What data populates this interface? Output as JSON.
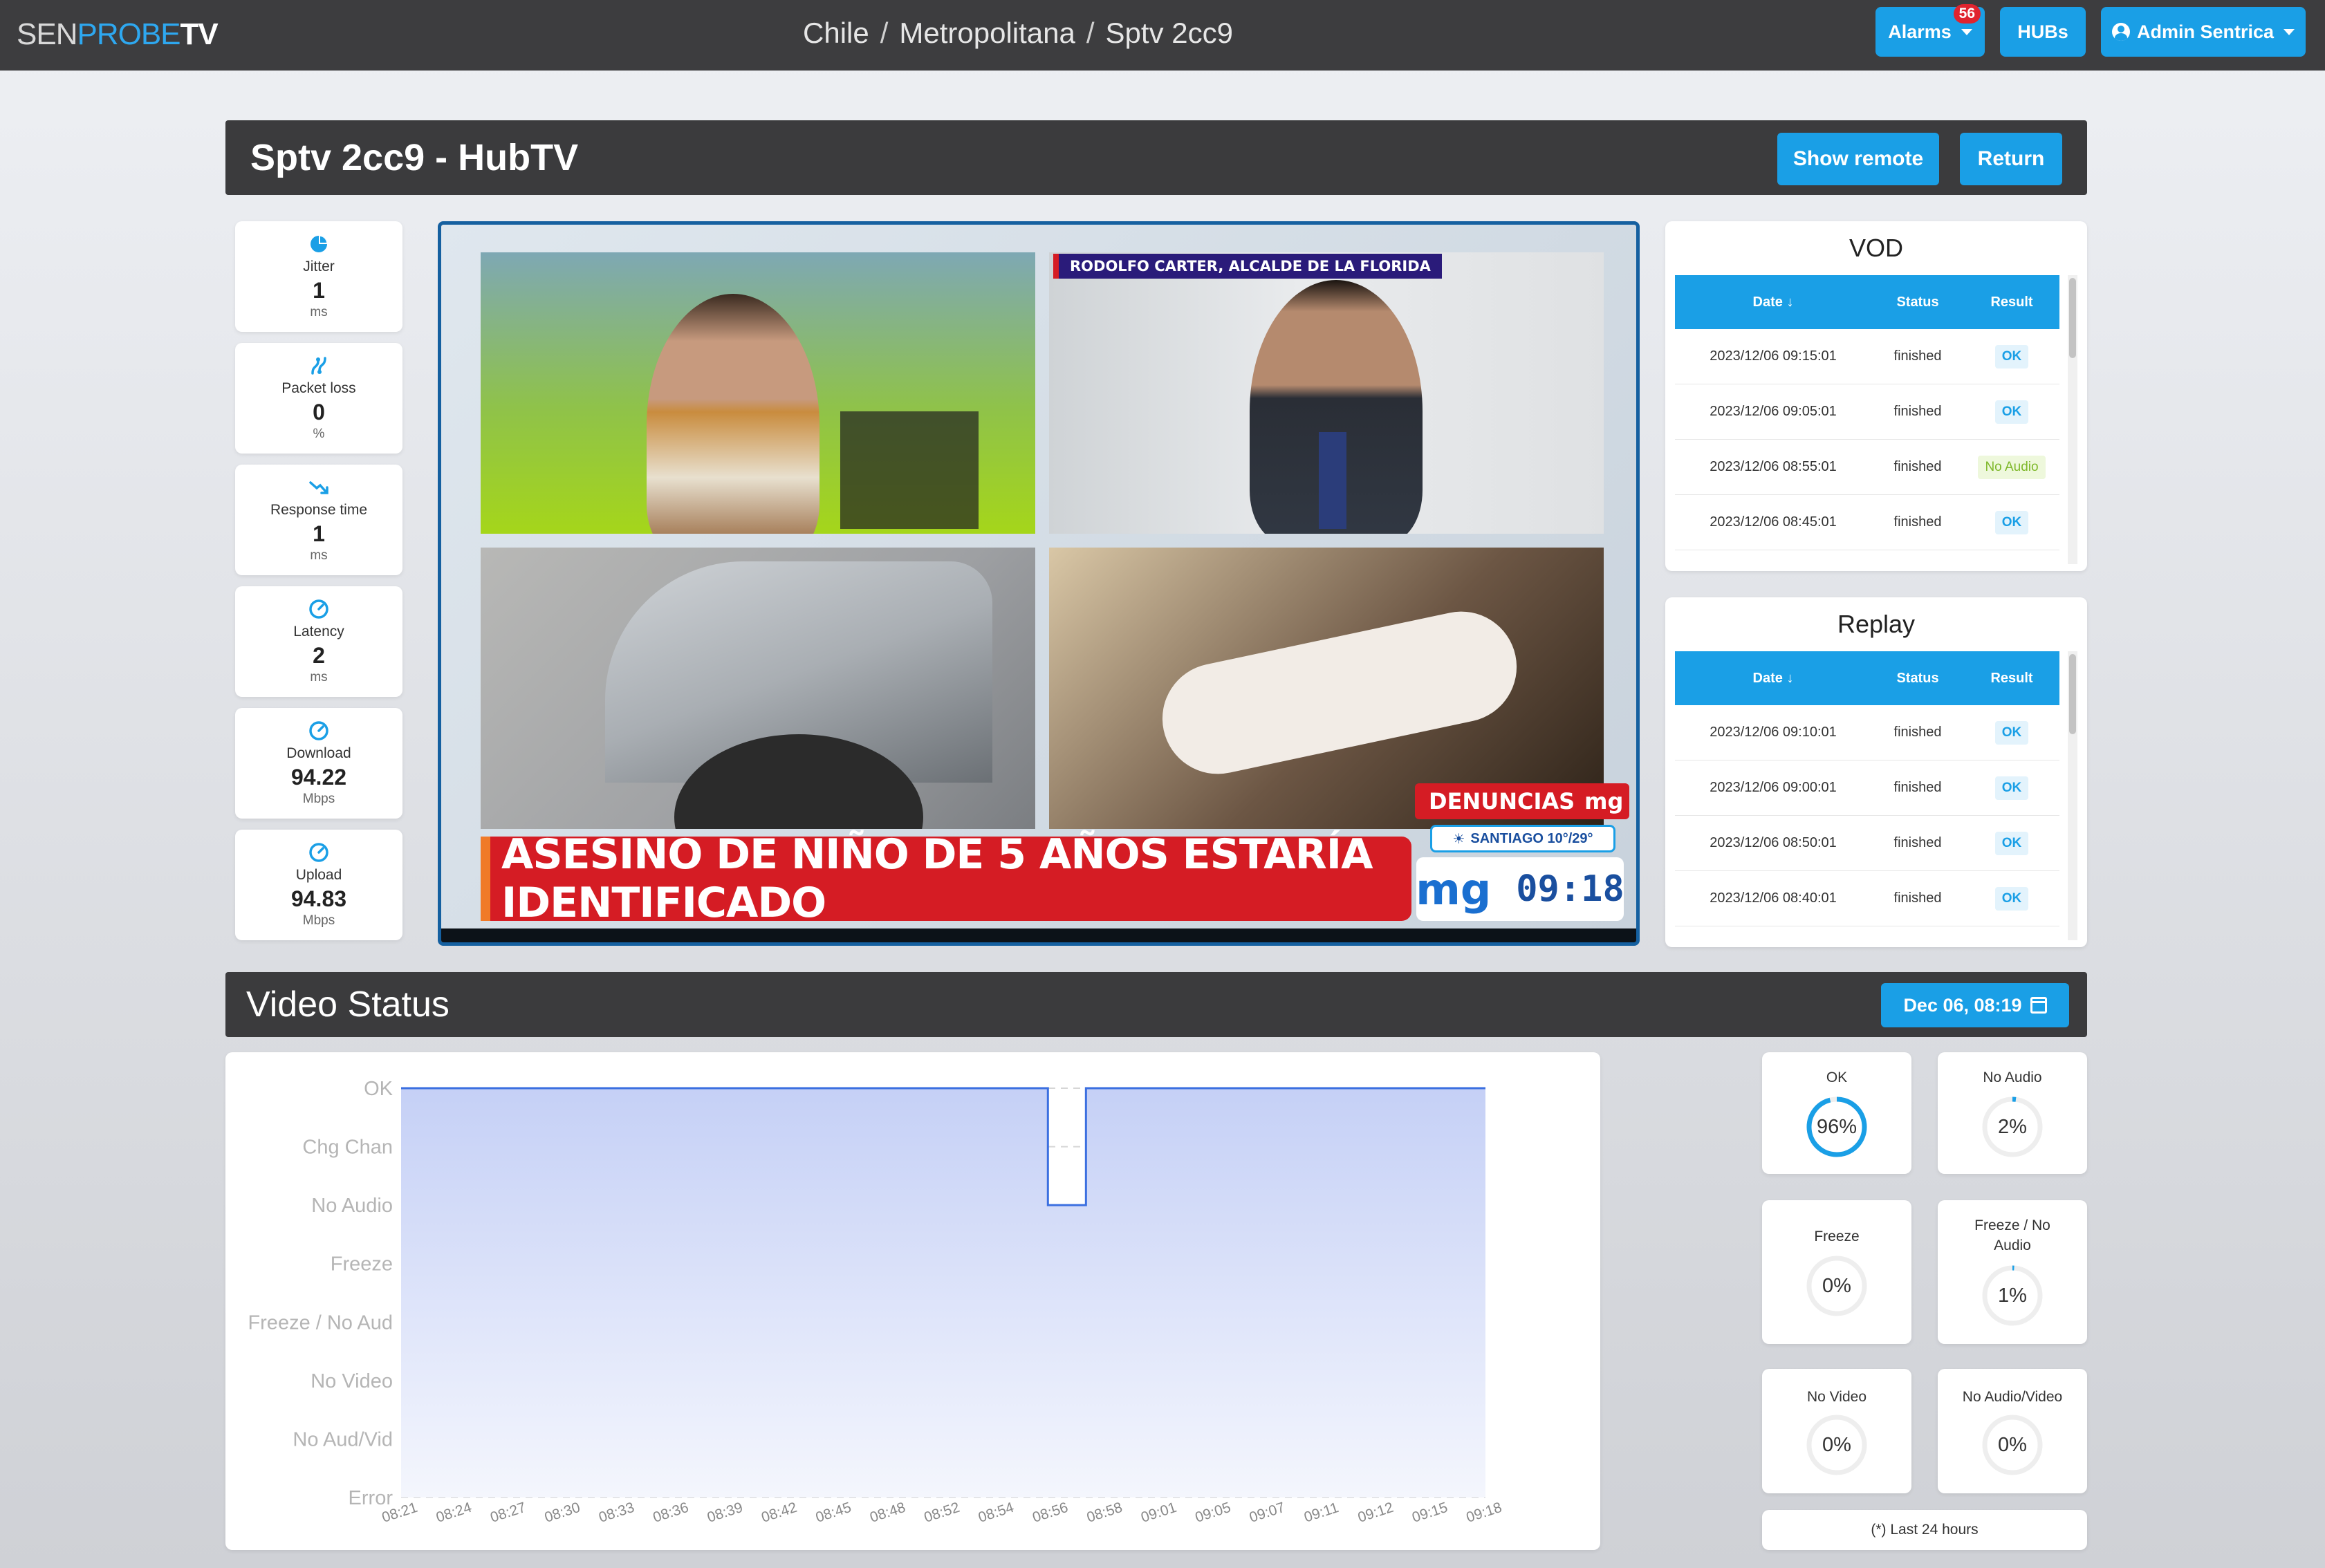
{
  "nav": {
    "logo": {
      "part1": "SEN",
      "part2": "PROBE",
      "part3": "TV"
    },
    "breadcrumb": [
      "Chile",
      "Metropolitana",
      "Sptv 2cc9"
    ],
    "alarms_label": "Alarms",
    "alarms_count": "56",
    "hubs_label": "HUBs",
    "user_label": "Admin Sentrica"
  },
  "device": {
    "title": "Sptv 2cc9 - HubTV",
    "show_remote_label": "Show remote",
    "return_label": "Return"
  },
  "metrics": [
    {
      "label": "Jitter",
      "value": "1",
      "unit": "ms",
      "icon": "pie-chart-icon"
    },
    {
      "label": "Packet loss",
      "value": "0",
      "unit": "%",
      "icon": "route-icon"
    },
    {
      "label": "Response time",
      "value": "1",
      "unit": "ms",
      "icon": "trend-down-icon"
    },
    {
      "label": "Latency",
      "value": "2",
      "unit": "ms",
      "icon": "gauge-icon"
    },
    {
      "label": "Download",
      "value": "94.22",
      "unit": "Mbps",
      "icon": "gauge-icon"
    },
    {
      "label": "Upload",
      "value": "94.83",
      "unit": "Mbps",
      "icon": "gauge-icon"
    }
  ],
  "video": {
    "caption": "RODOLFO CARTER, ALCALDE DE LA FLORIDA",
    "ticker": "ASESINO DE NIÑO DE 5 AÑOS ESTARÍA IDENTIFICADO",
    "brand": "DENUNCIAS",
    "brand_logo": "mg",
    "location_temp": "SANTIAGO 10°/29°",
    "clock": "09:18"
  },
  "vod": {
    "title": "VOD",
    "columns": [
      "Date ↓",
      "Status",
      "Result"
    ],
    "rows": [
      {
        "date": "2023/12/06 09:15:01",
        "status": "finished",
        "result": "OK"
      },
      {
        "date": "2023/12/06 09:05:01",
        "status": "finished",
        "result": "OK"
      },
      {
        "date": "2023/12/06 08:55:01",
        "status": "finished",
        "result": "No Audio"
      },
      {
        "date": "2023/12/06 08:45:01",
        "status": "finished",
        "result": "OK"
      }
    ]
  },
  "replay": {
    "title": "Replay",
    "columns": [
      "Date ↓",
      "Status",
      "Result"
    ],
    "rows": [
      {
        "date": "2023/12/06 09:10:01",
        "status": "finished",
        "result": "OK"
      },
      {
        "date": "2023/12/06 09:00:01",
        "status": "finished",
        "result": "OK"
      },
      {
        "date": "2023/12/06 08:50:01",
        "status": "finished",
        "result": "OK"
      },
      {
        "date": "2023/12/06 08:40:01",
        "status": "finished",
        "result": "OK"
      }
    ]
  },
  "video_status": {
    "title": "Video Status",
    "date_button": "Dec 06, 08:19"
  },
  "chart_data": {
    "type": "area",
    "y_categories": [
      "OK",
      "Chg Chan",
      "No Audio",
      "Freeze",
      "Freeze / No Aud",
      "No Video",
      "No Aud/Vid",
      "Error"
    ],
    "x_ticks": [
      "08:21",
      "08:24",
      "08:27",
      "08:30",
      "08:33",
      "08:36",
      "08:39",
      "08:42",
      "08:45",
      "08:48",
      "08:52",
      "08:54",
      "08:56",
      "08:58",
      "09:01",
      "09:05",
      "09:07",
      "09:11",
      "09:12",
      "09:15",
      "09:18"
    ],
    "series": [
      {
        "points": [
          {
            "x": "08:21",
            "y": "OK"
          },
          {
            "x": "08:55",
            "y": "OK"
          },
          {
            "x": "08:55",
            "y": "No Audio"
          },
          {
            "x": "08:57",
            "y": "No Audio"
          },
          {
            "x": "08:57",
            "y": "OK"
          },
          {
            "x": "09:18",
            "y": "OK"
          }
        ]
      }
    ],
    "grid": true,
    "line_color": "#3b6fe0",
    "fill_color": "#c9d4f7"
  },
  "stats": [
    {
      "label": "OK",
      "percent": 96,
      "text": "96%"
    },
    {
      "label": "No Audio",
      "percent": 2,
      "text": "2%"
    },
    {
      "label": "Freeze",
      "percent": 0,
      "text": "0%"
    },
    {
      "label": "Freeze / No Audio",
      "percent": 1,
      "text": "1%"
    },
    {
      "label": "No Video",
      "percent": 0,
      "text": "0%"
    },
    {
      "label": "No Audio/Video",
      "percent": 0,
      "text": "0%"
    }
  ],
  "footnote": "(*) Last 24 hours",
  "colors": {
    "accent": "#1a9fe6",
    "header": "#3b3b3d",
    "alert": "#e0242f",
    "chart_line": "#3b6fe0"
  }
}
